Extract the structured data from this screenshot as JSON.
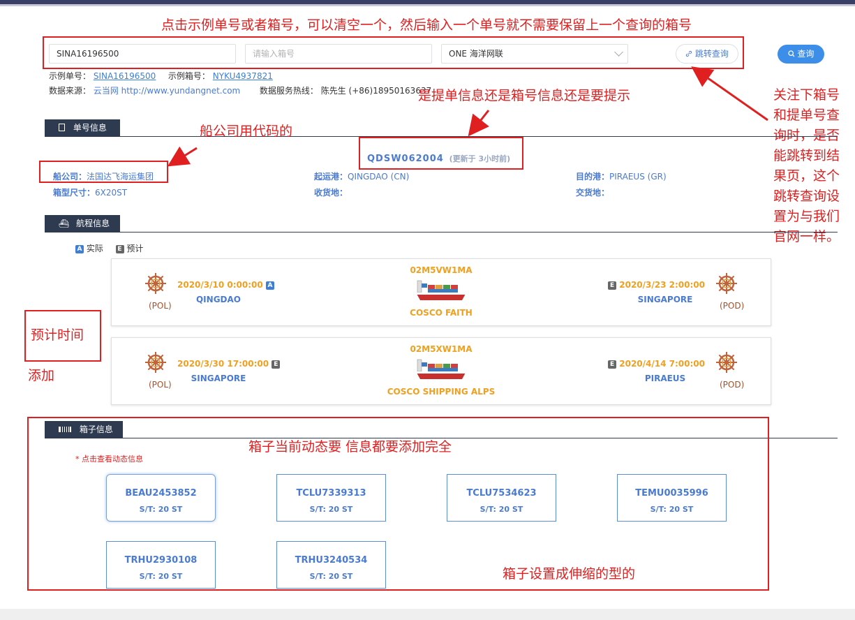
{
  "search": {
    "bill_value": "SINA16196500",
    "box_placeholder": "请输入箱号",
    "carrier_value": "ONE 海洋网联",
    "jump_label": "跳转查询",
    "query_label": "查询"
  },
  "examples": {
    "bill_label": "示例单号：",
    "bill_value": "SINA16196500",
    "box_label": "示例箱号：",
    "box_value": "NYKU4937821"
  },
  "source": {
    "label": "数据来源：",
    "value": "云当网 http://www.yundangnet.com",
    "hotline_label": "数据服务热线：",
    "hotline_value": "陈先生 (+86)18950163637"
  },
  "bill_section": {
    "title": "单号信息",
    "bill_no": "QDSW062004",
    "updated": "(更新于 3小时前)",
    "carrier_label": "船公司：",
    "carrier_value": "法国达飞海运集团",
    "pol_label": "起运港：",
    "pol_value": "QINGDAO (CN)",
    "pod_label": "目的港：",
    "pod_value": "PIRAEUS (GR)",
    "size_label": "箱型尺寸：",
    "size_value": "6X20ST",
    "receipt_label": "收货地：",
    "delivery_label": "交货地："
  },
  "voyage_section": {
    "title": "航程信息",
    "legend_actual": "实际",
    "legend_estimate": "预计",
    "legend_a": "A",
    "legend_e": "E",
    "legs": [
      {
        "voyage": "02M5VW1MA",
        "vessel": "COSCO FAITH",
        "dep_time": "2020/3/10 0:00:00",
        "dep_flag": "A",
        "dep_port": "QINGDAO",
        "dep_role": "(POL)",
        "arr_time": "2020/3/23 2:00:00",
        "arr_flag": "E",
        "arr_port": "SINGAPORE",
        "arr_role": "(POD)"
      },
      {
        "voyage": "02M5XW1MA",
        "vessel": "COSCO SHIPPING ALPS",
        "dep_time": "2020/3/30 17:00:00",
        "dep_flag": "E",
        "dep_port": "SINGAPORE",
        "dep_role": "(POL)",
        "arr_time": "2020/4/14 7:00:00",
        "arr_flag": "E",
        "arr_port": "PIRAEUS",
        "arr_role": "(POD)"
      }
    ]
  },
  "container_section": {
    "title": "箱子信息",
    "hint": "* 点击查看动态信息",
    "boxes": [
      {
        "no": "BEAU2453852",
        "st": "S/T:  20 ST"
      },
      {
        "no": "TCLU7339313",
        "st": "S/T:  20 ST"
      },
      {
        "no": "TCLU7534623",
        "st": "S/T:  20 ST"
      },
      {
        "no": "TEMU0035996",
        "st": "S/T:  20 ST"
      },
      {
        "no": "TRHU2930108",
        "st": "S/T:  20 ST"
      },
      {
        "no": "TRHU3240534",
        "st": "S/T:  20 ST"
      }
    ]
  },
  "annotations": {
    "top": "点击示例单号或者箱号，可以清空一个，然后输入一个单号就不需要保留上一个查询的箱号",
    "right": "关注下箱号和提单号查询时，是否能跳转到结果页，这个跳转查询设置为与我们官网一样。",
    "hint_prompt": "是提单信息还是箱号信息还是要提示",
    "carrier_code": "船公司用代码的",
    "eta": "预计时间",
    "add": "添加",
    "container_dynamic": "箱子当前动态要 信息都要添加完全",
    "collapsible": "箱子设置成伸缩的型的"
  },
  "colors": {
    "annotation_red": "#e02020",
    "accent_blue": "#3d8ee8",
    "section_dark": "#2d3a50",
    "time_orange": "#f0a020"
  }
}
